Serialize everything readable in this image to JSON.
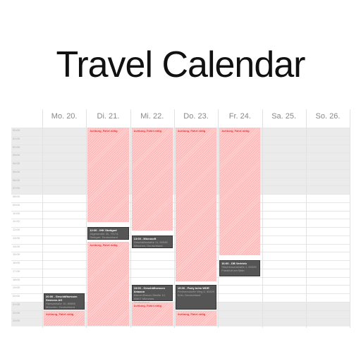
{
  "title": "Travel Calendar",
  "days": [
    "Mo. 20.",
    "Di. 21.",
    "Mi. 22.",
    "Do. 23.",
    "Fr. 24.",
    "Sa. 25.",
    "So. 26."
  ],
  "hours": [
    "00:00",
    "01:00",
    "02:00",
    "03:00",
    "04:00",
    "05:00",
    "06:00",
    "07:00",
    "08:00",
    "09:00",
    "10:00",
    "11:00",
    "12:00",
    "13:00",
    "14:00",
    "15:00",
    "16:00",
    "17:00",
    "18:00",
    "19:00",
    "20:00",
    "21:00",
    "22:00",
    "23:00"
  ],
  "blocked_label": "Achtung, Fahrt nötig",
  "blocks": [
    {
      "day": 0,
      "start": 22.1,
      "end": 24
    },
    {
      "day": 1,
      "start": 0,
      "end": 11.5
    },
    {
      "day": 1,
      "start": 13.8,
      "end": 24
    },
    {
      "day": 2,
      "start": 0,
      "end": 12.5
    },
    {
      "day": 2,
      "start": 21.1,
      "end": 24
    },
    {
      "day": 3,
      "start": 0,
      "end": 18.6
    },
    {
      "day": 3,
      "start": 22.1,
      "end": 24
    },
    {
      "day": 4,
      "start": 0,
      "end": 15.5
    }
  ],
  "events": [
    {
      "day": 0,
      "start": 20,
      "end": 22,
      "title": "20:00 - Geschäftsessen Siemens AG",
      "address": "Hansastraße 10, 80686 München, Deutschland"
    },
    {
      "day": 1,
      "start": 12,
      "end": 13.6,
      "title": "12:00 - IHK Stuttgart",
      "address": "Jägerstraße 30, 70174 Stuttgart, Deutschland"
    },
    {
      "day": 2,
      "start": 13,
      "end": 14.6,
      "title": "13:00 - Microsoft",
      "address": "Geschäftsstraße 11, 80538 München, Deutschland"
    },
    {
      "day": 2,
      "start": 19,
      "end": 21,
      "title": "19:00 - Geschäftsessen Amazon",
      "address": "Marcel-Breuer-Straße 12, 80807 München, Deutschland"
    },
    {
      "day": 3,
      "start": 19,
      "end": 22,
      "title": "19:00 - Party beim WDR",
      "address": "Freimersdorfer Weg 6, 50829 Köln, Deutschland"
    },
    {
      "day": 4,
      "start": 16,
      "end": 18,
      "title": "16:00 - DB Vertrieb",
      "address": "Stephensonstraße 1, 60326 Frankfurt am Main"
    }
  ]
}
